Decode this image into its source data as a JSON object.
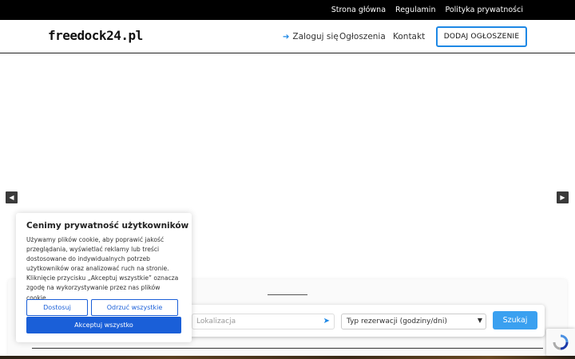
{
  "topbar": {
    "links": [
      "Strona główna",
      "Regulamin",
      "Polityka prywatności"
    ]
  },
  "header": {
    "logo": "freedock24.pl",
    "login_label": "Zaloguj się",
    "nav": [
      "Ogłoszenia",
      "Kontakt"
    ],
    "add_button": "DODAJ OGŁOSZENIE"
  },
  "slider": {
    "prev_icon": "chevron-left-icon",
    "next_icon": "chevron-right-icon"
  },
  "search": {
    "location_placeholder": "Lokalizacja",
    "location_icon": "location-arrow-icon",
    "reservation_type": "Typ rezerwacji (godziny/dni)",
    "submit_label": "Szukaj"
  },
  "cookie": {
    "title": "Cenimy prywatność użytkowników",
    "text": "Używamy plików cookie, aby poprawić jakość przeglądania, wyświetlać reklamy lub treści dostosowane do indywidualnych potrzeb użytkowników oraz analizować ruch na stronie. Kliknięcie przycisku „Akceptuj wszystkie” oznacza zgodę na wykorzystywanie przez nas plików cookie.",
    "customize": "Dostosuj",
    "reject_all": "Odrzuć wszystkie",
    "accept_all": "Akceptuj wszystko"
  },
  "colors": {
    "accent": "#1e88e5",
    "cookie_blue": "#1a5fd8",
    "search_button": "#3aa0f0"
  }
}
